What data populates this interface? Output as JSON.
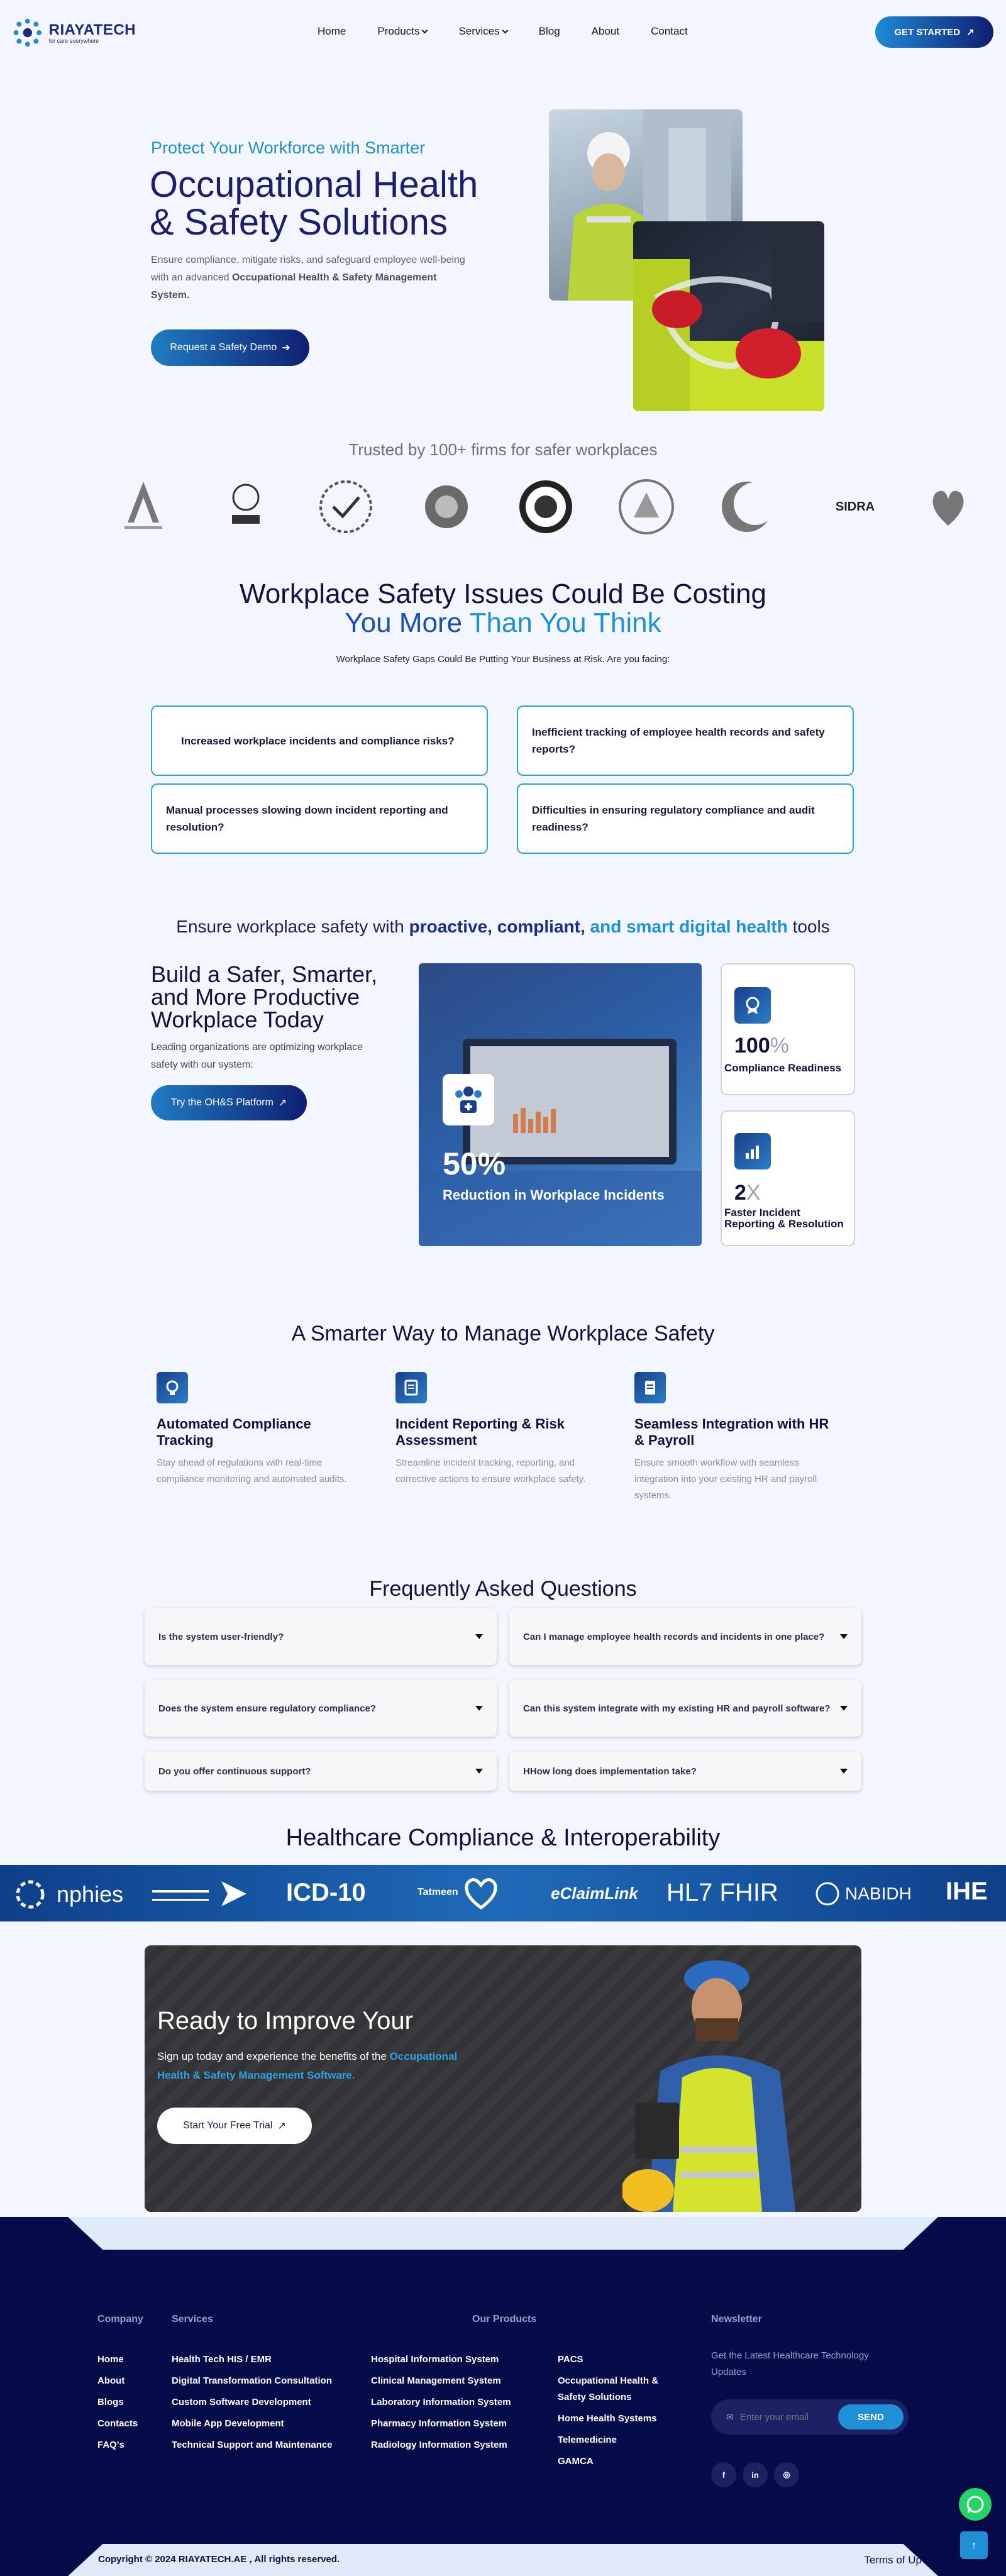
{
  "header": {
    "logo_name": "RIAYATECH",
    "logo_tag": "for care everywhere",
    "nav": [
      "Home",
      "Products",
      "Services",
      "Blog",
      "About",
      "Contact"
    ],
    "cta": "GET STARTED"
  },
  "hero": {
    "kicker": "Protect Your Workforce with Smarter",
    "title": "Occupational Health & Safety Solutions",
    "desc_plain": "Ensure compliance, mitigate risks, and safeguard employee well-being with an advanced",
    "desc_bold": "Occupational Health & Safety Management System.",
    "button": "Request a Safety Demo"
  },
  "trusted": {
    "title": "Trusted by 100+ firms for safer workplaces",
    "sidra": "SIDRA"
  },
  "issues": {
    "title_line1": "Workplace Safety Issues Could Be Costing",
    "title_line2a": "You More",
    "title_line2b": "Than You Think",
    "subtitle": "Workplace Safety Gaps Could Be Putting Your Business at Risk. Are you facing:",
    "cards": [
      "Increased workplace incidents and compliance risks?",
      "Inefficient tracking of employee health records and safety reports?",
      "Manual processes slowing down incident reporting and resolution?",
      "Difficulties in ensuring regulatory compliance and audit readiness?"
    ]
  },
  "proactive": {
    "pre": "Ensure workplace safety with",
    "h1": "proactive, compliant,",
    "h2": "and smart digital health",
    "post": "tools"
  },
  "build": {
    "title": "Build a Safer, Smarter, and More Productive Workplace Today",
    "desc": "Leading organizations are optimizing workplace safety with our system:",
    "button": "Try the OH&S Platform",
    "big_stat": "50%",
    "big_label": "Reduction in Workplace Incidents",
    "stat1_num": "100",
    "stat1_suffix": "%",
    "stat1_label": "Compliance Readiness",
    "stat2_num": "2",
    "stat2_suffix": "X",
    "stat2_label": "Faster Incident Reporting & Resolution"
  },
  "smarter": {
    "title": "A Smarter Way to Manage Workplace Safety",
    "features": [
      {
        "title": "Automated Compliance Tracking",
        "desc": "Stay ahead of regulations with real-time compliance monitoring and automated audits."
      },
      {
        "title": "Incident Reporting & Risk Assessment",
        "desc": "Streamline incident tracking, reporting, and corrective actions to ensure workplace safety."
      },
      {
        "title": "Seamless Integration with HR & Payroll",
        "desc": "Ensure smooth workflow with seamless integration into your existing HR and payroll systems."
      }
    ]
  },
  "faq": {
    "title": "Frequently Asked Questions",
    "items": [
      "Is the system user-friendly?",
      "Can I manage employee health records and incidents in one place?",
      "Does the system ensure regulatory compliance?",
      "Can this system integrate with my existing HR and payroll software?",
      "Do you offer continuous support?",
      "HHow long does implementation take?"
    ]
  },
  "compliance": {
    "title": "Healthcare Compliance & Interoperability",
    "logos": [
      "nphies",
      "ICD-10",
      "Tatmeen",
      "eClaimLink",
      "HL7 FHIR",
      "NABIDH",
      "IHE"
    ]
  },
  "ready": {
    "title": "Ready to Improve Your",
    "desc_plain": "Sign up today and experience the benefits of the",
    "desc_hl": "Occupational Health & Safety Management Software.",
    "button": "Start Your Free Trial"
  },
  "footer": {
    "company_head": "Company",
    "company": [
      "Home",
      "About",
      "Blogs",
      "Contacts",
      "FAQ's"
    ],
    "services_head": "Services",
    "services": [
      "Health Tech HIS / EMR",
      "Digital Transformation Consultation",
      "Custom Software Development",
      "Mobile App Development",
      "Technical Support and Maintenance"
    ],
    "products_head": "Our Products",
    "products_a": [
      "Hospital Information System",
      "Clinical Management System",
      "Laboratory Information System",
      "Pharmacy Information System",
      "Radiology Information System"
    ],
    "products_b": [
      "PACS",
      "Occupational Health & Safety Solutions",
      "Home Health Systems",
      "Telemedicine",
      "GAMCA"
    ],
    "newsletter_head": "Newsletter",
    "newsletter_desc": "Get the Latest Healthcare Technology Updates",
    "email_placeholder": "Enter your email",
    "send": "SEND",
    "copyright": "Copyright © 2024 RIAYATECH.AE , All rights reserved.",
    "terms": "Terms of Up"
  },
  "colors": {
    "navy": "#0d1240",
    "brand_blue": "#1f8fd6",
    "footer_bg": "#060b4a",
    "card_border": "#2aa3d8"
  }
}
